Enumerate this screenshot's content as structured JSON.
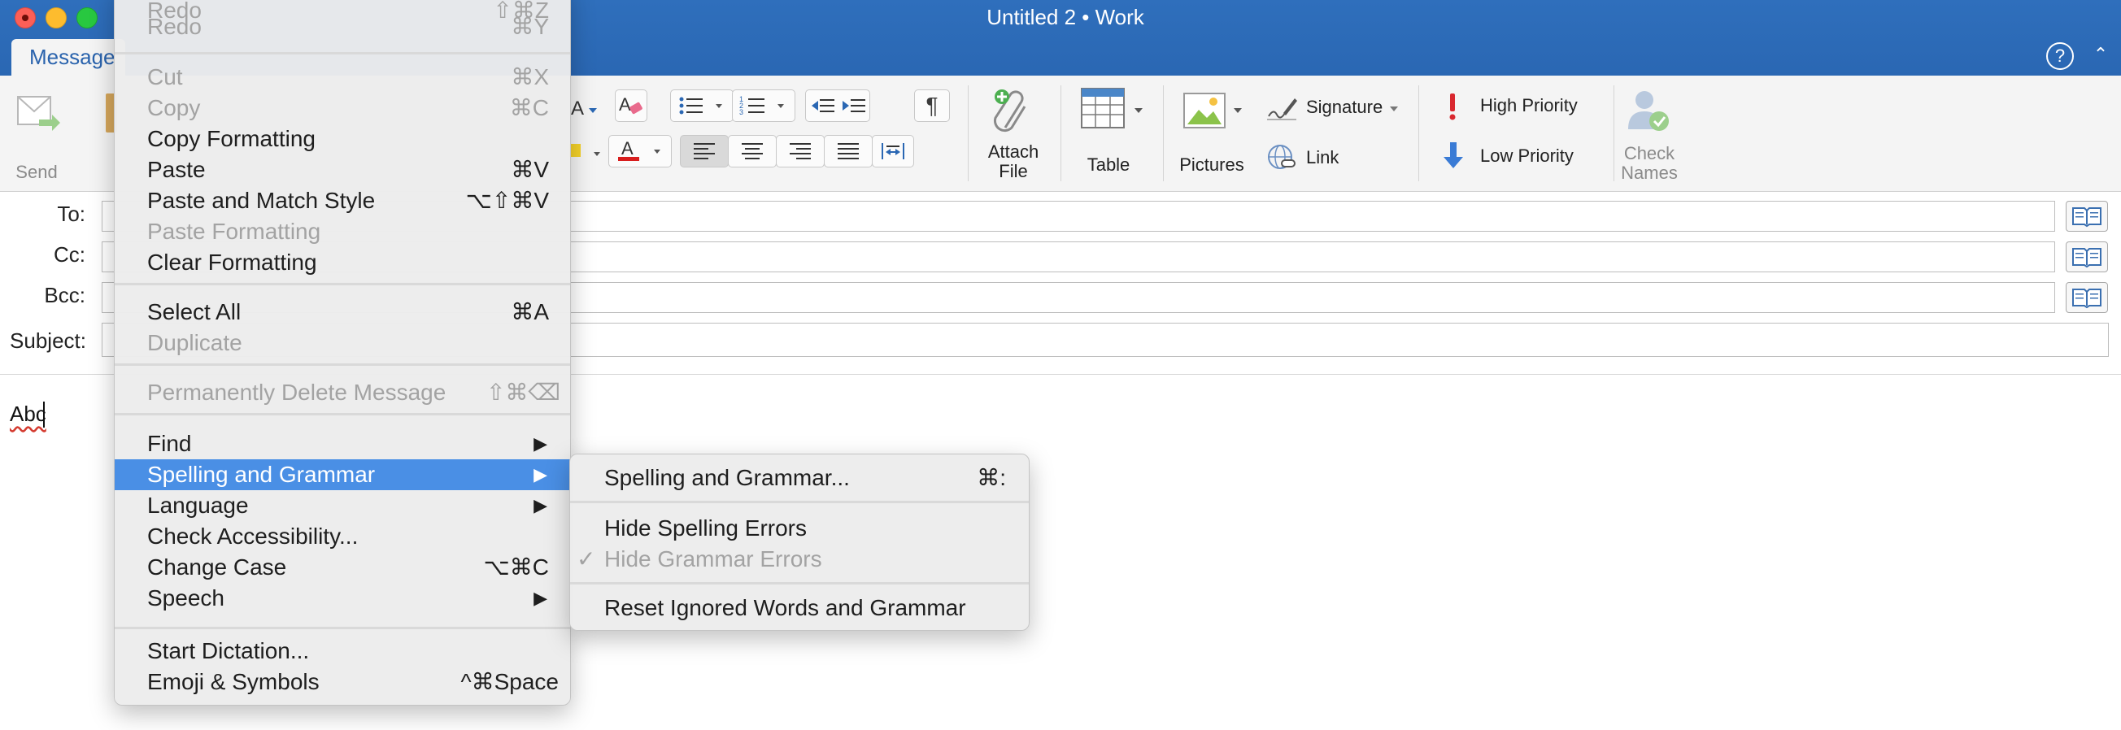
{
  "window": {
    "title": "Untitled 2 • Work",
    "tab": "Message"
  },
  "icons": {
    "help": "?",
    "collapse": "⌃"
  },
  "ribbon": {
    "send": "Send",
    "attach_file": [
      "Attach",
      "File"
    ],
    "table": "Table",
    "pictures": "Pictures",
    "signature": "Signature",
    "link": "Link",
    "high_priority": "High Priority",
    "low_priority": "Low Priority",
    "check_names": [
      "Check",
      "Names"
    ]
  },
  "fields": {
    "to": "To:",
    "cc": "Cc:",
    "bcc": "Bcc:",
    "subject": "Subject:"
  },
  "body": {
    "text": "Abc"
  },
  "edit_menu": [
    {
      "label": "Redo",
      "shortcut": "⇧⌘Z",
      "disabled": true
    },
    {
      "label": "Redo",
      "shortcut": "⌘Y",
      "disabled": true
    },
    {
      "label": "Cut",
      "shortcut": "⌘X",
      "disabled": true
    },
    {
      "label": "Copy",
      "shortcut": "⌘C",
      "disabled": true
    },
    {
      "label": "Copy Formatting",
      "shortcut": "",
      "disabled": false
    },
    {
      "label": "Paste",
      "shortcut": "⌘V",
      "disabled": false
    },
    {
      "label": "Paste and Match Style",
      "shortcut": "⌥⇧⌘V",
      "disabled": false
    },
    {
      "label": "Paste Formatting",
      "shortcut": "",
      "disabled": true
    },
    {
      "label": "Clear Formatting",
      "shortcut": "",
      "disabled": false
    },
    {
      "label": "Select All",
      "shortcut": "⌘A",
      "disabled": false
    },
    {
      "label": "Duplicate",
      "shortcut": "",
      "disabled": true
    },
    {
      "label": "Permanently Delete Message",
      "shortcut": "⇧⌘⌫",
      "disabled": true
    },
    {
      "label": "Find",
      "shortcut": "▶",
      "disabled": false
    },
    {
      "label": "Spelling and Grammar",
      "shortcut": "▶",
      "disabled": false,
      "highlighted": true
    },
    {
      "label": "Language",
      "shortcut": "▶",
      "disabled": false
    },
    {
      "label": "Check Accessibility...",
      "shortcut": "",
      "disabled": false
    },
    {
      "label": "Change Case",
      "shortcut": "⌥⌘C",
      "disabled": false
    },
    {
      "label": "Speech",
      "shortcut": "▶",
      "disabled": false
    },
    {
      "label": "Start Dictation...",
      "shortcut": "",
      "disabled": false
    },
    {
      "label": "Emoji & Symbols",
      "shortcut": "^⌘Space",
      "disabled": false
    }
  ],
  "spelling_submenu": [
    {
      "label": "Spelling and Grammar...",
      "shortcut": "⌘:",
      "disabled": false
    },
    {
      "label": "Hide Spelling Errors",
      "shortcut": "",
      "disabled": false
    },
    {
      "label": "Hide Grammar Errors",
      "shortcut": "",
      "disabled": true,
      "checked": true,
      "check": "✓"
    },
    {
      "label": "Reset Ignored Words and Grammar",
      "shortcut": "",
      "disabled": false
    }
  ],
  "colors": {
    "titlebar": "#2a67b3",
    "menu_highlight": "#4a8fe5",
    "ribbon": "#f4f4f4"
  }
}
